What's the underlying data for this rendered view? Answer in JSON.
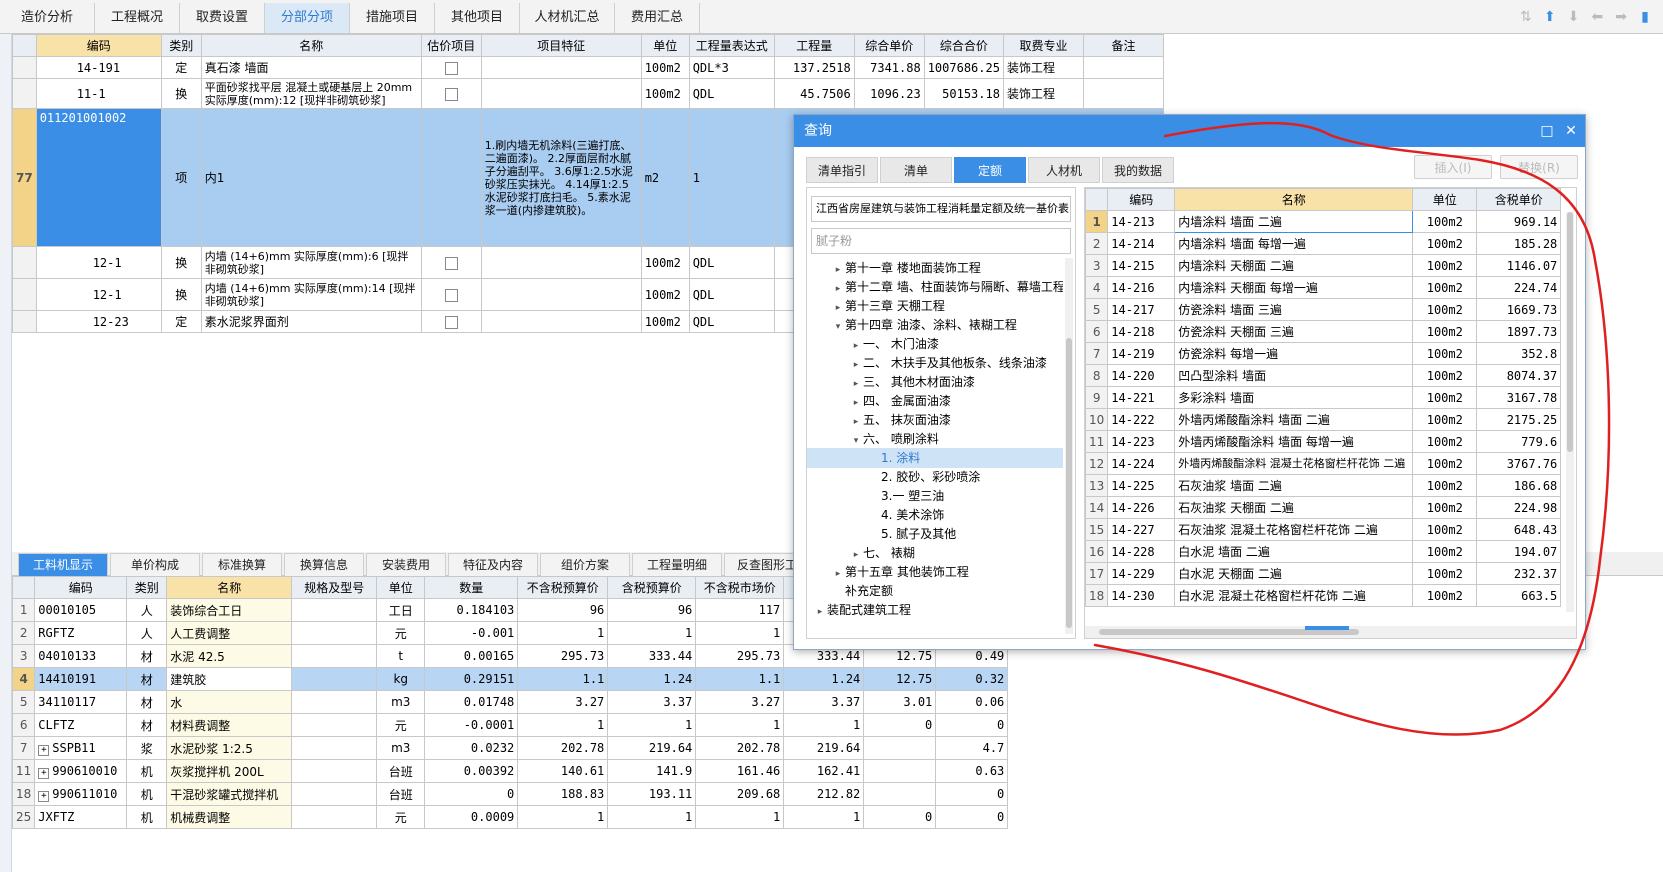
{
  "top_tabs": [
    "造价分析",
    "工程概况",
    "取费设置",
    "分部分项",
    "措施项目",
    "其他项目",
    "人材机汇总",
    "费用汇总"
  ],
  "top_active": "分部分项",
  "upper_table": {
    "headers": [
      "编码",
      "类别",
      "名称",
      "估价项目",
      "项目特征",
      "单位",
      "工程量表达式",
      "工程量",
      "综合单价",
      "综合合价",
      "取费专业",
      "备注"
    ],
    "rows": [
      {
        "code": "14-191",
        "type": "定",
        "name": "真石漆 墙面",
        "unit": "100m2",
        "expr": "QDL*3",
        "qty": "137.2518",
        "price": "7341.88",
        "total": "1007686.25",
        "major": "装饰工程"
      },
      {
        "code": "11-1",
        "type": "换",
        "name": "平面砂浆找平层 混凝土或硬基层上 20mm 实际厚度(mm):12 [现拌非砌筑砂浆]",
        "unit": "100m2",
        "expr": "QDL",
        "qty": "45.7506",
        "price": "1096.23",
        "total": "50153.18",
        "major": "装饰工程"
      },
      {
        "rownum": "77",
        "code": "011201001002",
        "type": "项",
        "name": "内1",
        "feature": "1.刷内墙无机涂料(三遍打底、二遍面漆)。 2.2厚面层耐水腻子分遍刮平。 3.6厚1:2.5水泥砂浆压实抹光。 4.14厚1:2.5水泥砂浆打底扫毛。 5.素水泥浆一道(内掺建筑胶)。",
        "unit": "m2",
        "expr": "1"
      },
      {
        "code": "12-1",
        "type": "换",
        "name": "内墙 (14+6)mm 实际厚度(mm):6 [现拌非砌筑砂浆]",
        "unit": "100m2",
        "expr": "QDL"
      },
      {
        "code": "12-1",
        "type": "换",
        "name": "内墙 (14+6)mm 实际厚度(mm):14 [现拌非砌筑砂浆]",
        "unit": "100m2",
        "expr": "QDL"
      },
      {
        "code": "12-23",
        "type": "定",
        "name": "素水泥浆界面剂",
        "unit": "100m2",
        "expr": "QDL"
      }
    ]
  },
  "lower_tabs": [
    "工料机显示",
    "单价构成",
    "标准换算",
    "换算信息",
    "安装费用",
    "特征及内容",
    "组价方案",
    "工程量明细",
    "反查图形工程量"
  ],
  "lower_active": "工料机显示",
  "lower_table": {
    "headers": [
      "编码",
      "类别",
      "名称",
      "规格及型号",
      "单位",
      "数量",
      "不含税预算价",
      "含税预算价",
      "不含税市场价",
      "含"
    ],
    "rows": [
      {
        "n": "1",
        "code": "00010105",
        "type": "人",
        "name": "装饰综合工日",
        "spec": "",
        "unit": "工日",
        "qty": "0.184103",
        "p1": "96",
        "p2": "96",
        "p3": "117",
        "p4": "",
        "p5": "",
        "p6": ""
      },
      {
        "n": "2",
        "code": "RGFTZ",
        "type": "人",
        "name": "人工费调整",
        "spec": "",
        "unit": "元",
        "qty": "-0.001",
        "p1": "1",
        "p2": "1",
        "p3": "1",
        "p4": "",
        "p5": "",
        "p6": ""
      },
      {
        "n": "3",
        "code": "04010133",
        "type": "材",
        "name": "水泥 42.5",
        "spec": "",
        "unit": "t",
        "qty": "0.00165",
        "p1": "295.73",
        "p2": "333.44",
        "p3": "295.73",
        "p4": "333.44",
        "p5": "12.75",
        "p6": "0.49"
      },
      {
        "n": "4",
        "code": "14410191",
        "type": "材",
        "name": "建筑胶",
        "spec": "",
        "unit": "kg",
        "qty": "0.29151",
        "p1": "1.1",
        "p2": "1.24",
        "p3": "1.1",
        "p4": "1.24",
        "p5": "12.75",
        "p6": "0.32",
        "selected": true
      },
      {
        "n": "5",
        "code": "34110117",
        "type": "材",
        "name": "水",
        "spec": "",
        "unit": "m3",
        "qty": "0.01748",
        "p1": "3.27",
        "p2": "3.37",
        "p3": "3.27",
        "p4": "3.37",
        "p5": "3.01",
        "p6": "0.06"
      },
      {
        "n": "6",
        "code": "CLFTZ",
        "type": "材",
        "name": "材料费调整",
        "spec": "",
        "unit": "元",
        "qty": "-0.0001",
        "p1": "1",
        "p2": "1",
        "p3": "1",
        "p4": "1",
        "p5": "0",
        "p6": "0"
      },
      {
        "n": "7",
        "code": "SSPB11",
        "type": "浆",
        "name": "水泥砂浆 1:2.5",
        "spec": "",
        "unit": "m3",
        "qty": "0.0232",
        "p1": "202.78",
        "p2": "219.64",
        "p3": "202.78",
        "p4": "219.64",
        "p5": "",
        "p6": "4.7",
        "expand": true
      },
      {
        "n": "11",
        "code": "990610010",
        "type": "机",
        "name": "灰浆搅拌机 200L",
        "spec": "",
        "unit": "台班",
        "qty": "0.00392",
        "p1": "140.61",
        "p2": "141.9",
        "p3": "161.46",
        "p4": "162.41",
        "p5": "",
        "p6": "0.63",
        "expand": true
      },
      {
        "n": "18",
        "code": "990611010",
        "type": "机",
        "name": "干混砂浆罐式搅拌机",
        "spec": "",
        "unit": "台班",
        "qty": "0",
        "p1": "188.83",
        "p2": "193.11",
        "p3": "209.68",
        "p4": "212.82",
        "p5": "",
        "p6": "0",
        "expand": true
      },
      {
        "n": "25",
        "code": "JXFTZ",
        "type": "机",
        "name": "机械费调整",
        "spec": "",
        "unit": "元",
        "qty": "0.0009",
        "p1": "1",
        "p2": "1",
        "p3": "1",
        "p4": "1",
        "p5": "0",
        "p6": "0"
      }
    ]
  },
  "dialog": {
    "title": "查询",
    "tabs": [
      "清单指引",
      "清单",
      "定额",
      "人材机",
      "我的数据"
    ],
    "active_tab": "定额",
    "insert_label": "插入(I)",
    "replace_label": "替换(R)",
    "library": "江西省房屋建筑与装饰工程消耗量定额及统一基价表",
    "search_placeholder": "腻子粉",
    "tree": [
      {
        "label": "第十一章 楼地面装饰工程",
        "level": 1,
        "arrow": "▸"
      },
      {
        "label": "第十二章 墙、柱面装饰与隔断、幕墙工程",
        "level": 1,
        "arrow": "▸"
      },
      {
        "label": "第十三章 天棚工程",
        "level": 1,
        "arrow": "▸"
      },
      {
        "label": "第十四章 油漆、涂料、裱糊工程",
        "level": 1,
        "arrow": "▾"
      },
      {
        "label": "一、 木门油漆",
        "level": 2,
        "arrow": "▸"
      },
      {
        "label": "二、 木扶手及其他板条、线条油漆",
        "level": 2,
        "arrow": "▸"
      },
      {
        "label": "三、 其他木材面油漆",
        "level": 2,
        "arrow": "▸"
      },
      {
        "label": "四、 金属面油漆",
        "level": 2,
        "arrow": "▸"
      },
      {
        "label": "五、 抹灰面油漆",
        "level": 2,
        "arrow": "▸"
      },
      {
        "label": "六、 喷刷涂料",
        "level": 2,
        "arrow": "▾"
      },
      {
        "label": "1. 涂料",
        "level": 3,
        "arrow": "",
        "selected": true
      },
      {
        "label": "2. 胶砂、彩砂喷涂",
        "level": 3,
        "arrow": ""
      },
      {
        "label": "3.一 塑三油",
        "level": 3,
        "arrow": ""
      },
      {
        "label": "4. 美术涂饰",
        "level": 3,
        "arrow": ""
      },
      {
        "label": "5. 腻子及其他",
        "level": 3,
        "arrow": ""
      },
      {
        "label": "七、 裱糊",
        "level": 2,
        "arrow": "▸"
      },
      {
        "label": "第十五章 其他装饰工程",
        "level": 1,
        "arrow": "▸"
      },
      {
        "label": "补充定额",
        "level": 1,
        "arrow": ""
      },
      {
        "label": "装配式建筑工程",
        "level": 0,
        "arrow": "▸"
      }
    ],
    "result_headers": [
      "编码",
      "名称",
      "单位",
      "含税单价"
    ],
    "results": [
      {
        "n": "1",
        "code": "14-213",
        "name": "内墙涂料 墙面 二遍",
        "unit": "100m2",
        "price": "969.14"
      },
      {
        "n": "2",
        "code": "14-214",
        "name": "内墙涂料 墙面 每增一遍",
        "unit": "100m2",
        "price": "185.28"
      },
      {
        "n": "3",
        "code": "14-215",
        "name": "内墙涂料 天棚面 二遍",
        "unit": "100m2",
        "price": "1146.07"
      },
      {
        "n": "4",
        "code": "14-216",
        "name": "内墙涂料 天棚面 每增一遍",
        "unit": "100m2",
        "price": "224.74"
      },
      {
        "n": "5",
        "code": "14-217",
        "name": "仿瓷涂料 墙面 三遍",
        "unit": "100m2",
        "price": "1669.73"
      },
      {
        "n": "6",
        "code": "14-218",
        "name": "仿瓷涂料 天棚面 三遍",
        "unit": "100m2",
        "price": "1897.73"
      },
      {
        "n": "7",
        "code": "14-219",
        "name": "仿瓷涂料 每增一遍",
        "unit": "100m2",
        "price": "352.8"
      },
      {
        "n": "8",
        "code": "14-220",
        "name": "凹凸型涂料 墙面",
        "unit": "100m2",
        "price": "8074.37"
      },
      {
        "n": "9",
        "code": "14-221",
        "name": "多彩涂料 墙面",
        "unit": "100m2",
        "price": "3167.78"
      },
      {
        "n": "10",
        "code": "14-222",
        "name": "外墙丙烯酸酯涂料 墙面 二遍",
        "unit": "100m2",
        "price": "2175.25"
      },
      {
        "n": "11",
        "code": "14-223",
        "name": "外墙丙烯酸酯涂料 墙面 每增一遍",
        "unit": "100m2",
        "price": "779.6"
      },
      {
        "n": "12",
        "code": "14-224",
        "name": "外墙丙烯酸酯涂料 混凝土花格窗栏杆花饰 二遍",
        "unit": "100m2",
        "price": "3767.76"
      },
      {
        "n": "13",
        "code": "14-225",
        "name": "石灰油浆 墙面 二遍",
        "unit": "100m2",
        "price": "186.68"
      },
      {
        "n": "14",
        "code": "14-226",
        "name": "石灰油浆 天棚面 二遍",
        "unit": "100m2",
        "price": "224.98"
      },
      {
        "n": "15",
        "code": "14-227",
        "name": "石灰油浆 混凝土花格窗栏杆花饰 二遍",
        "unit": "100m2",
        "price": "648.43"
      },
      {
        "n": "16",
        "code": "14-228",
        "name": "白水泥 墙面 二遍",
        "unit": "100m2",
        "price": "194.07"
      },
      {
        "n": "17",
        "code": "14-229",
        "name": "白水泥 天棚面 二遍",
        "unit": "100m2",
        "price": "232.37"
      },
      {
        "n": "18",
        "code": "14-230",
        "name": "白水泥 混凝土花格窗栏杆花饰 二遍",
        "unit": "100m2",
        "price": "663.5"
      }
    ]
  },
  "colors": {
    "accent": "#3a8ee6",
    "selection": "#a9ccf1",
    "highlight_header": "#f9e2a8",
    "annotation": "#e02020"
  }
}
